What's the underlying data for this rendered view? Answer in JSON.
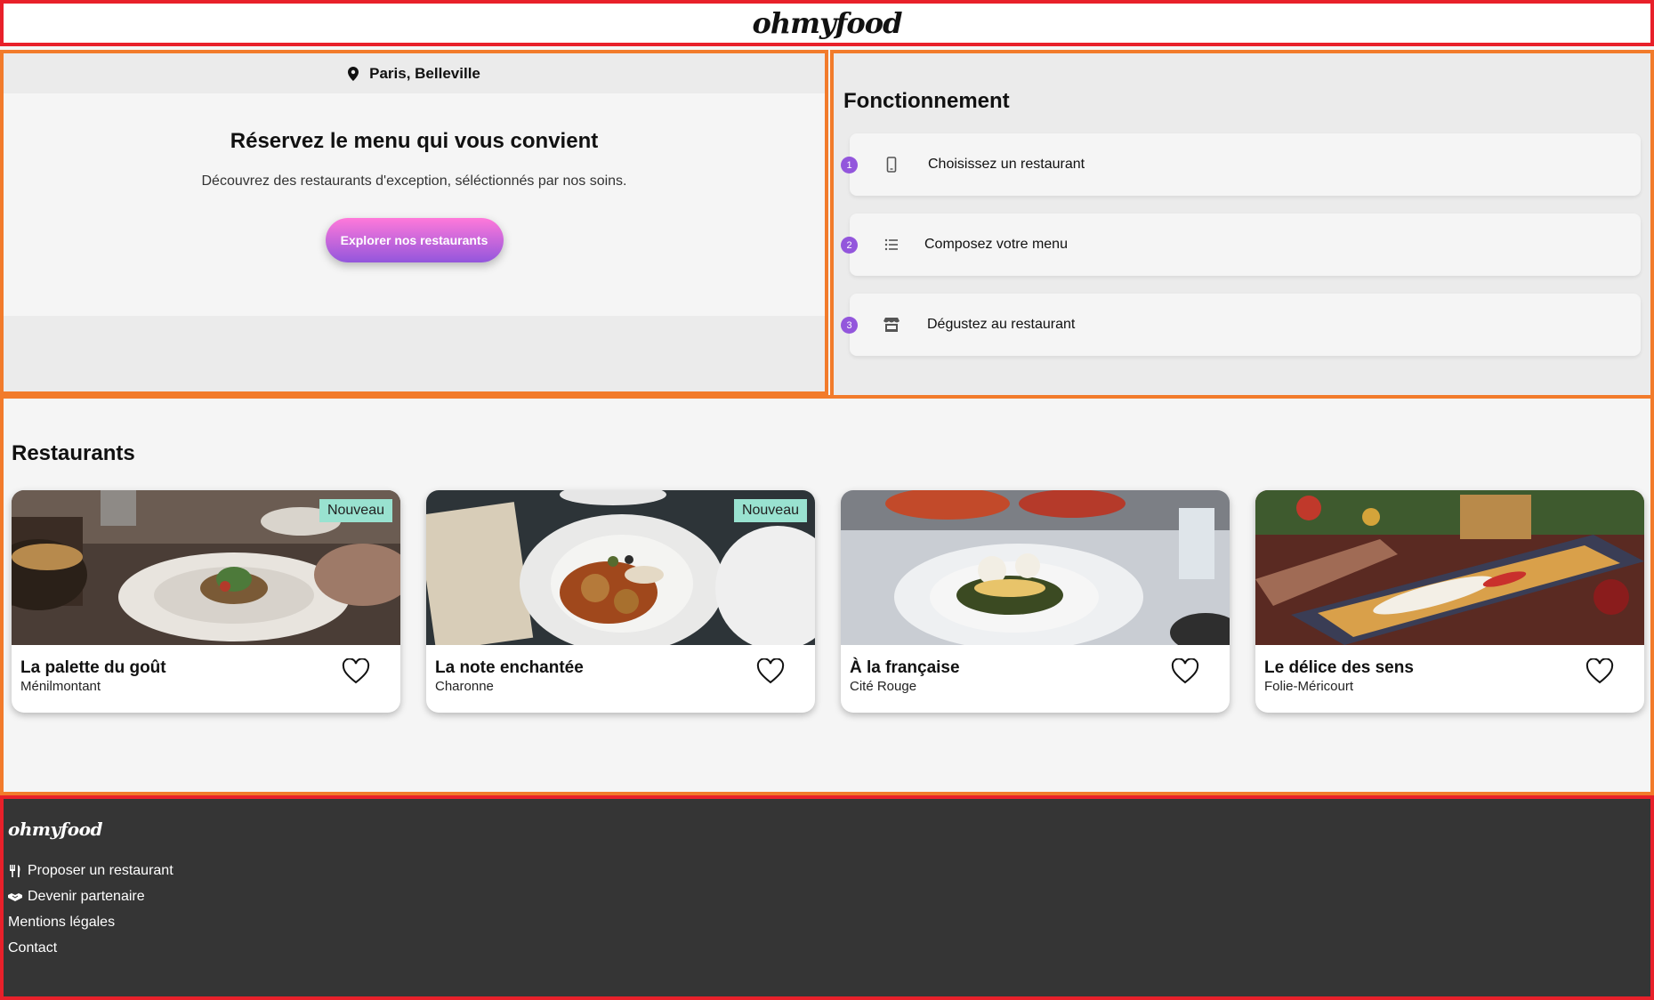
{
  "header": {
    "logo": "ohmyfood"
  },
  "hero": {
    "location_icon": "map-pin-icon",
    "location": "Paris, Belleville",
    "title": "Réservez le menu qui vous convient",
    "subtitle": "Découvrez des restaurants d'exception, séléctionnés par nos soins.",
    "cta_label": "Explorer nos restaurants",
    "accent_gradient": [
      "#ff79da",
      "#9356dc"
    ]
  },
  "how": {
    "title": "Fonctionnement",
    "steps": [
      {
        "number": "1",
        "icon": "mobile-phone-icon",
        "label": "Choisissez un restaurant"
      },
      {
        "number": "2",
        "icon": "list-icon",
        "label": "Composez votre menu"
      },
      {
        "number": "3",
        "icon": "storefront-icon",
        "label": "Dégustez au restaurant"
      }
    ]
  },
  "restaurants": {
    "title": "Restaurants",
    "cards": [
      {
        "name": "La palette du goût",
        "location": "Ménilmontant",
        "badge": "Nouveau"
      },
      {
        "name": "La note enchantée",
        "location": "Charonne",
        "badge": "Nouveau"
      },
      {
        "name": "À la française",
        "location": "Cité Rouge",
        "badge": ""
      },
      {
        "name": "Le délice des sens",
        "location": "Folie-Méricourt",
        "badge": ""
      }
    ]
  },
  "footer": {
    "logo": "ohmyfood",
    "links": [
      {
        "icon": "utensils-icon",
        "label": "Proposer un restaurant"
      },
      {
        "icon": "handshake-icon",
        "label": "Devenir partenaire"
      },
      {
        "icon": "",
        "label": "Mentions légales"
      },
      {
        "icon": "",
        "label": "Contact"
      }
    ]
  },
  "colors": {
    "header_border": "#e8202a",
    "section_border": "#f27b2b",
    "badge": "#99e2d0",
    "footer_bg": "#353535",
    "step_number": "#9356dc"
  }
}
